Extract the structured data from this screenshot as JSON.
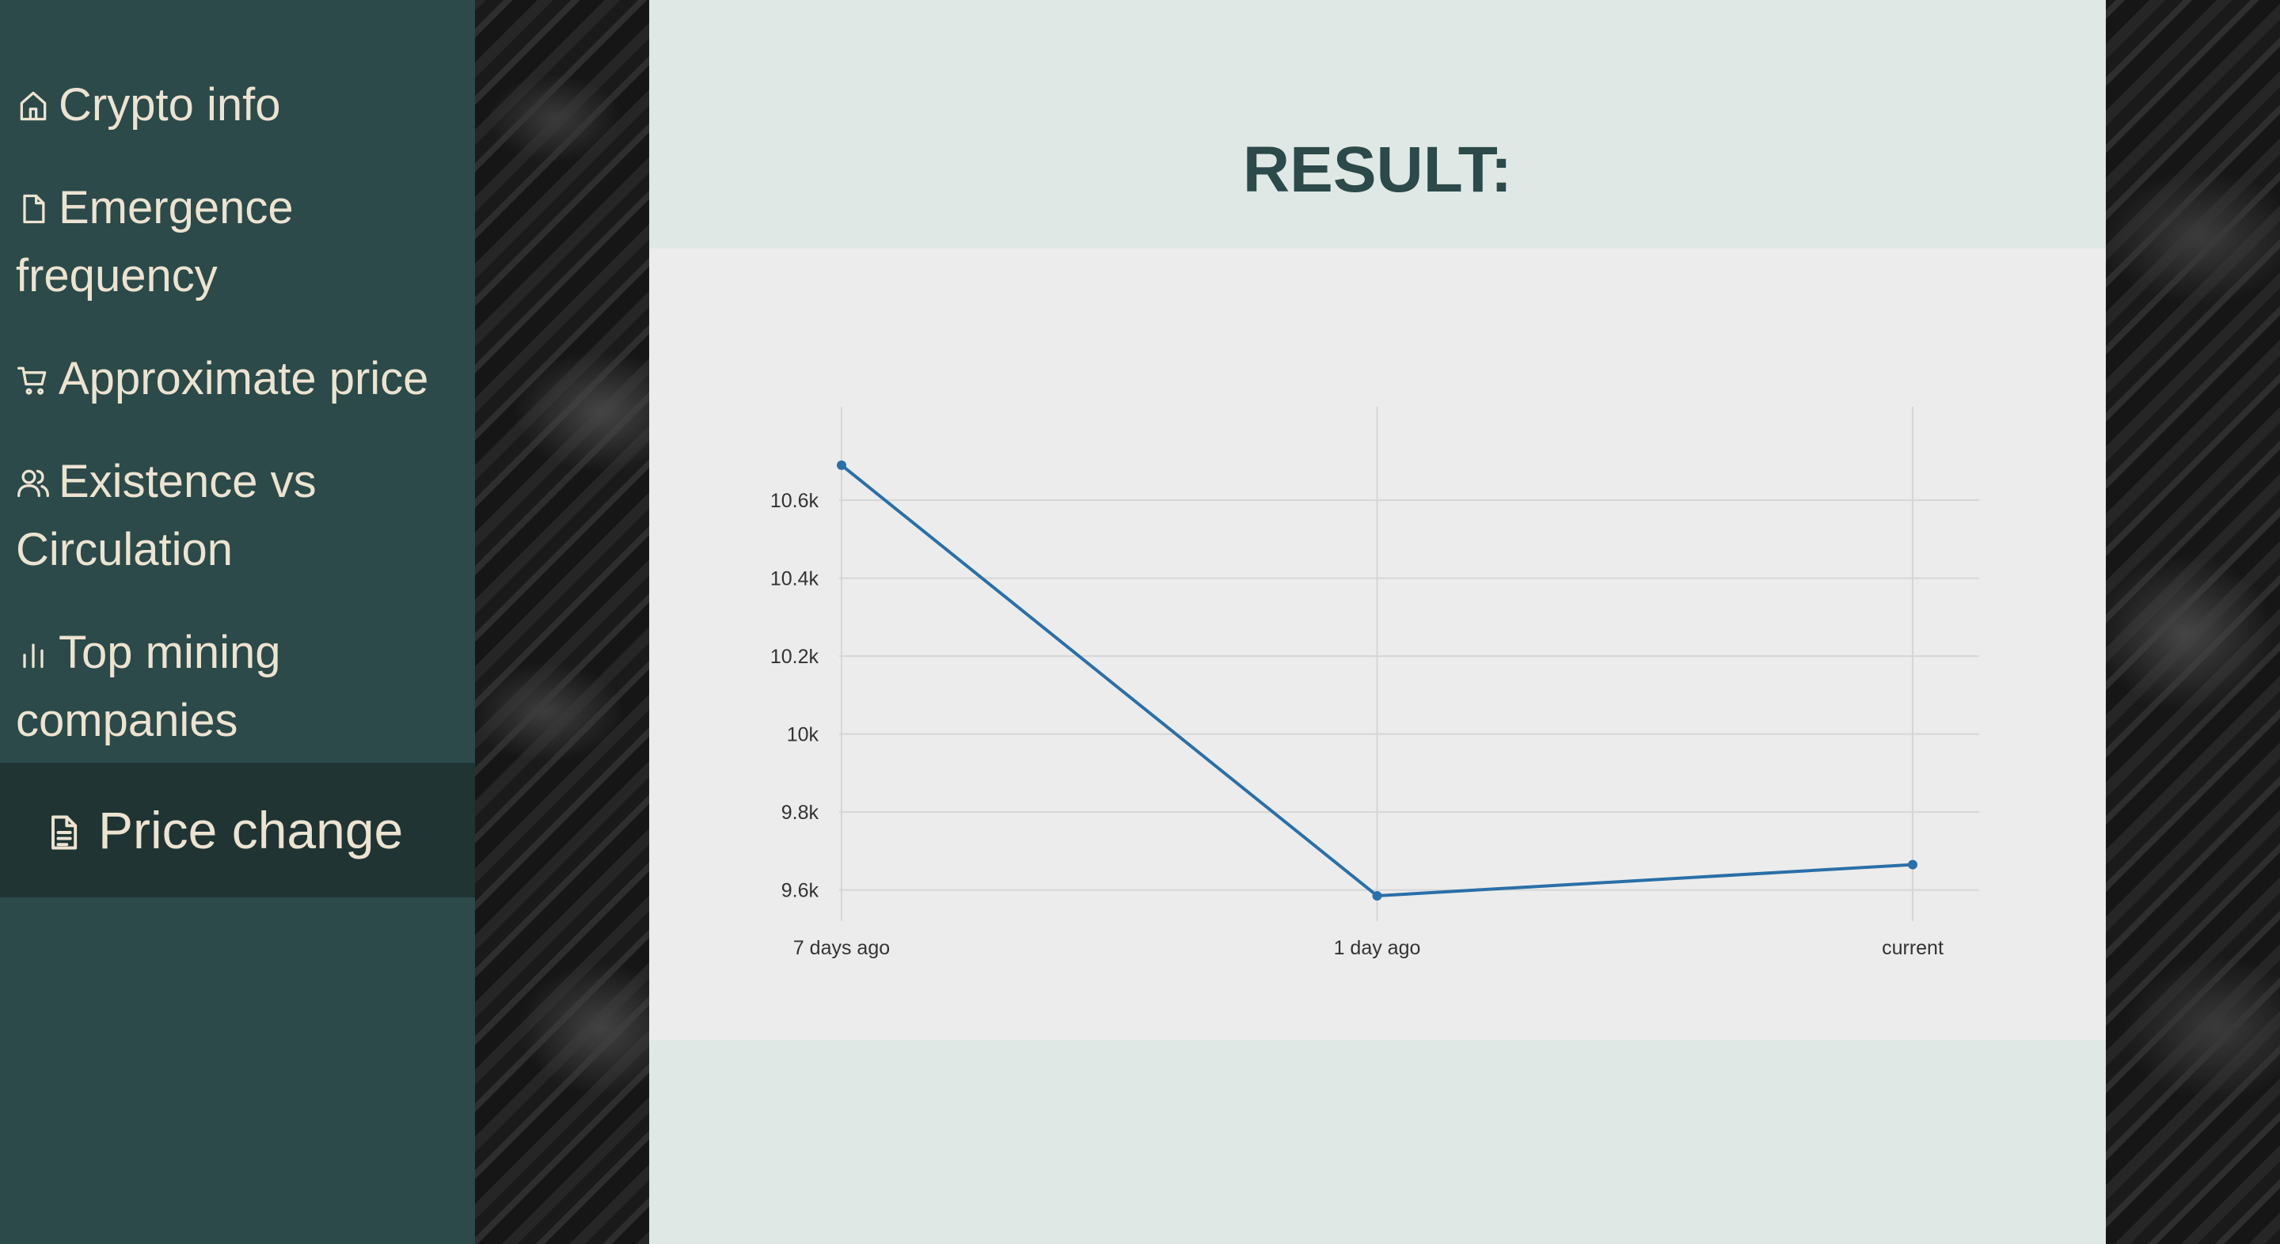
{
  "sidebar": {
    "items": [
      {
        "label": "Crypto info",
        "icon": "home-icon"
      },
      {
        "label": "Emergence frequency",
        "icon": "file-icon"
      },
      {
        "label": "Approximate price",
        "icon": "cart-icon"
      },
      {
        "label": "Existence vs Circulation",
        "icon": "users-icon"
      },
      {
        "label": "Top mining companies",
        "icon": "bar-chart-icon"
      },
      {
        "label": "Price change",
        "icon": "file-text-icon",
        "active": true
      }
    ]
  },
  "main": {
    "title": "RESULT:"
  },
  "colors": {
    "sidebar_bg": "#2b4a49",
    "sidebar_active_bg": "#1f3433",
    "sidebar_text": "#ede3d1",
    "title_color": "#2b4a49",
    "line_color": "#2a6fa8"
  },
  "chart_data": {
    "type": "line",
    "categories": [
      "7 days ago",
      "1 day ago",
      "current"
    ],
    "values": [
      10690,
      9585,
      9665
    ],
    "yticks": [
      9600,
      9800,
      10000,
      10200,
      10400,
      10600
    ],
    "yticklabels": [
      "9.6k",
      "9.8k",
      "10k",
      "10.2k",
      "10.4k",
      "10.6k"
    ],
    "ylim": [
      9520,
      10840
    ],
    "grid": true,
    "title": "",
    "xlabel": "",
    "ylabel": ""
  }
}
